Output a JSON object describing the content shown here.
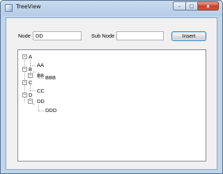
{
  "window": {
    "title": "TreeView",
    "minimize": "–",
    "maximize": "□",
    "close": "x"
  },
  "form": {
    "node_label": "Node",
    "node_value": "DD",
    "subnode_label": "Sub Node",
    "subnode_value": "",
    "insert_label": "Insert"
  },
  "tree": {
    "expander_symbol": "−",
    "nodes": [
      {
        "label": "A",
        "children": [
          "AA"
        ]
      },
      {
        "label": "B",
        "children": [
          {
            "label": "BB",
            "children": [
              "BBB"
            ]
          }
        ]
      },
      {
        "label": "C",
        "children": [
          "CC"
        ]
      },
      {
        "label": "D",
        "children": [
          {
            "label": "DD",
            "children": [
              "DDD"
            ]
          }
        ]
      }
    ],
    "labels": {
      "a": "A",
      "aa": "AA",
      "b": "B",
      "bb": "BB",
      "bbb": "BBB",
      "c": "C",
      "cc": "CC",
      "d": "D",
      "dd": "DD",
      "ddd": "DDD"
    }
  }
}
